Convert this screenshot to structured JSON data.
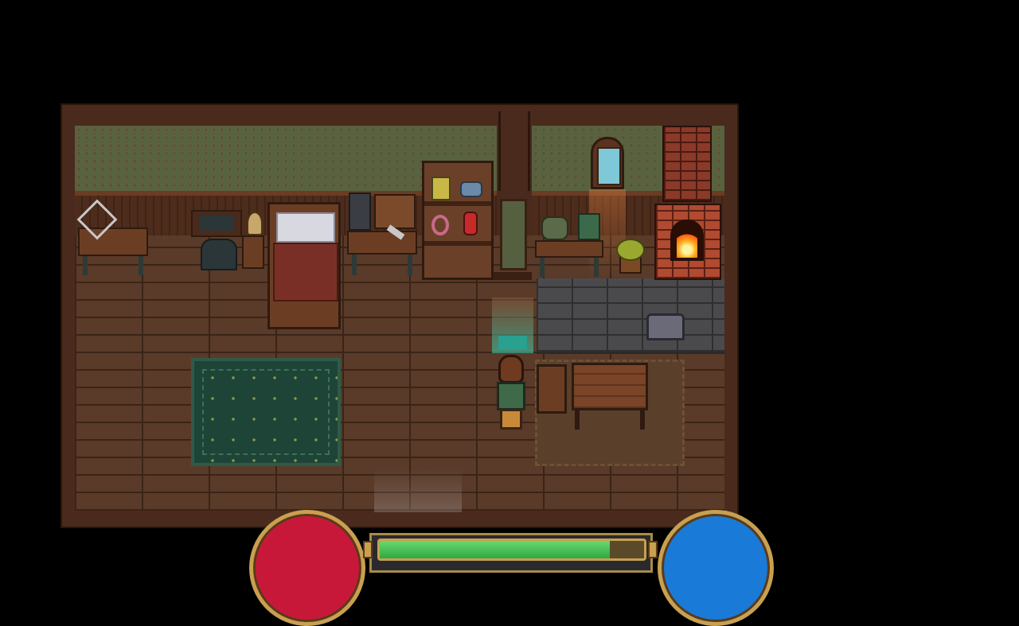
{
  "scene": {
    "location": "house-interior",
    "player_facing": "up"
  },
  "hud": {
    "health_orb_color": "#c8183a",
    "mana_orb_color": "#1a7ad8",
    "stamina_fraction": 0.87,
    "stamina_color": "#3ebf4e",
    "frame_color": "#c8a050"
  }
}
